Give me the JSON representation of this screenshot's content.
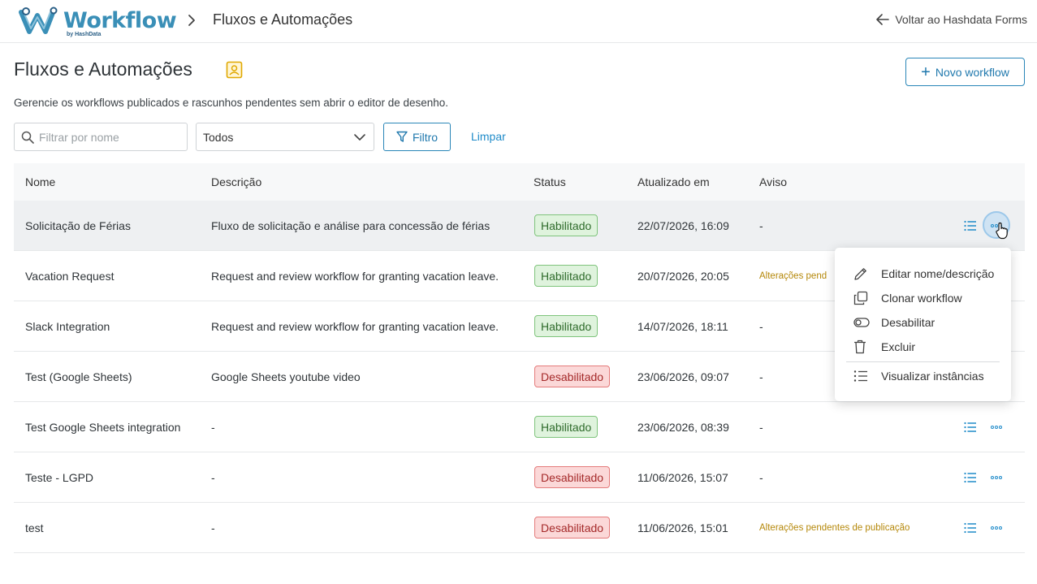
{
  "topbar": {
    "brand": "Workflow",
    "brand_by": "by HashData",
    "breadcrumb": "Fluxos e Automações",
    "back_label": "Voltar ao Hashdata Forms"
  },
  "page": {
    "title": "Fluxos e Automações",
    "subtitle": "Gerencie os workflows publicados e rascunhos pendentes sem abrir o editor de desenho.",
    "new_button": "Novo workflow"
  },
  "filters": {
    "search_placeholder": "Filtrar por nome",
    "status_selected": "Todos",
    "filter_button": "Filtro",
    "clear_link": "Limpar"
  },
  "table": {
    "headers": [
      "Nome",
      "Descrição",
      "Status",
      "Atualizado em",
      "Aviso"
    ],
    "rows": [
      {
        "name": "Solicitação de Férias",
        "description": "Fluxo de solicitação e análise para concessão de férias",
        "status": "Habilitado",
        "updated": "22/07/2026, 16:09",
        "notice": "-"
      },
      {
        "name": "Vacation Request",
        "description": "Request and review workflow for granting vacation leave.",
        "status": "Habilitado",
        "updated": "20/07/2026, 20:05",
        "notice": "Alterações pend"
      },
      {
        "name": "Slack Integration",
        "description": "Request and review workflow for granting vacation leave.",
        "status": "Habilitado",
        "updated": "14/07/2026, 18:11",
        "notice": "-"
      },
      {
        "name": "Test (Google Sheets)",
        "description": "Google Sheets youtube video",
        "status": "Desabilitado",
        "updated": "23/06/2026, 09:07",
        "notice": "-"
      },
      {
        "name": "Test Google Sheets integration",
        "description": "-",
        "status": "Habilitado",
        "updated": "23/06/2026, 08:39",
        "notice": "-"
      },
      {
        "name": "Teste - LGPD",
        "description": "-",
        "status": "Desabilitado",
        "updated": "11/06/2026, 15:07",
        "notice": "-"
      },
      {
        "name": "test",
        "description": "-",
        "status": "Desabilitado",
        "updated": "11/06/2026, 15:01",
        "notice": "Alterações pendentes de publicação"
      }
    ]
  },
  "context_menu": {
    "edit": "Editar nome/descrição",
    "clone": "Clonar workflow",
    "disable": "Desabilitar",
    "delete": "Excluir",
    "instances": "Visualizar instâncias"
  },
  "colors": {
    "accent": "#1f78ad",
    "enabled_bg": "#dff3dd",
    "disabled_bg": "#fbd8d8",
    "warning_text": "#b5880a"
  }
}
